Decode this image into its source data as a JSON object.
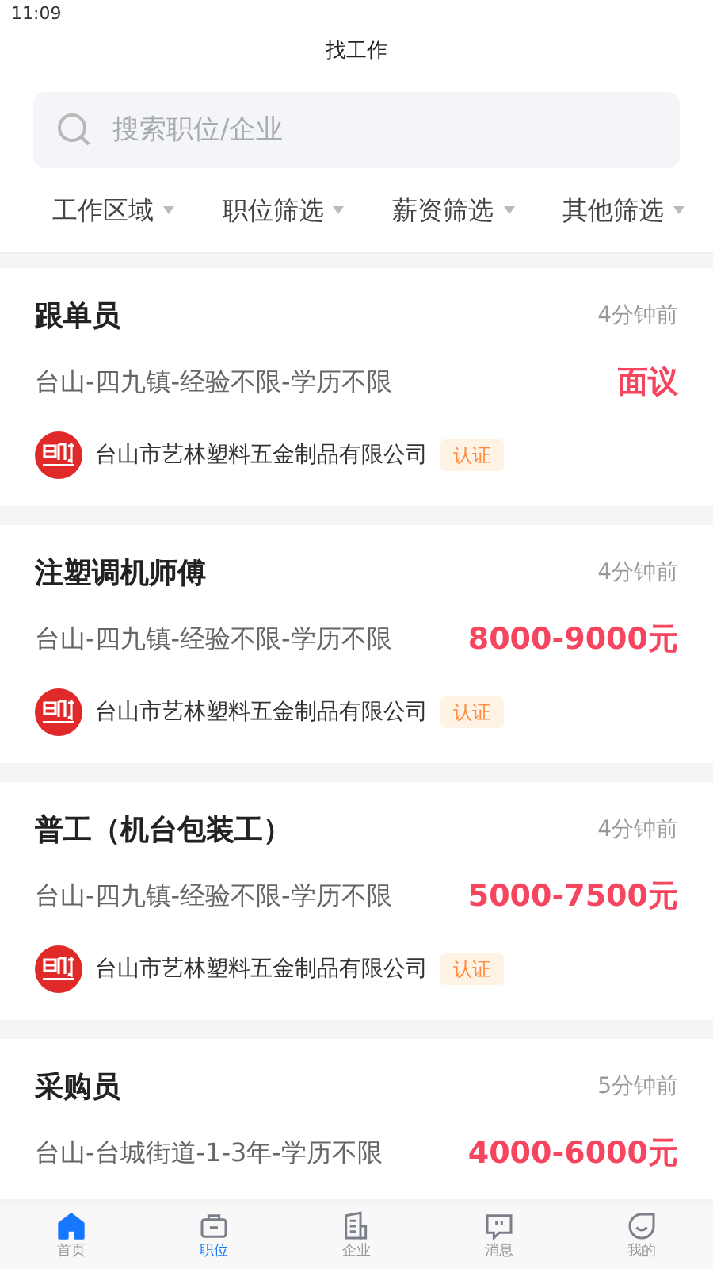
{
  "status_bar": {
    "time": "11:09"
  },
  "title": "找工作",
  "search": {
    "placeholder": "搜索职位/企业"
  },
  "filters": [
    {
      "label": "工作区域"
    },
    {
      "label": "职位筛选"
    },
    {
      "label": "薪资筛选"
    },
    {
      "label": "其他筛选"
    }
  ],
  "jobs": [
    {
      "title": "跟单员",
      "time": "4分钟前",
      "details": "台山-四九镇-经验不限-学历不限",
      "salary": "面议",
      "company": "台山市艺林塑料五金制品有限公司",
      "badge": "认证"
    },
    {
      "title": "注塑调机师傅",
      "time": "4分钟前",
      "details": "台山-四九镇-经验不限-学历不限",
      "salary": "8000-9000元",
      "company": "台山市艺林塑料五金制品有限公司",
      "badge": "认证"
    },
    {
      "title": "普工（机台包装工）",
      "time": "4分钟前",
      "details": "台山-四九镇-经验不限-学历不限",
      "salary": "5000-7500元",
      "company": "台山市艺林塑料五金制品有限公司",
      "badge": "认证"
    },
    {
      "title": "采购员",
      "time": "5分钟前",
      "details": "台山-台城街道-1-3年-学历不限",
      "salary": "4000-6000元"
    }
  ],
  "tab_bar": [
    {
      "kind": "home",
      "label": "首页",
      "selected": false,
      "icon_highlighted": true
    },
    {
      "kind": "briefcase",
      "label": "职位",
      "selected": true,
      "icon_highlighted": false
    },
    {
      "kind": "building",
      "label": "企业",
      "selected": false,
      "icon_highlighted": false
    },
    {
      "kind": "message",
      "label": "消息",
      "selected": false,
      "icon_highlighted": false
    },
    {
      "kind": "face",
      "label": "我的",
      "selected": false,
      "icon_highlighted": false
    }
  ]
}
